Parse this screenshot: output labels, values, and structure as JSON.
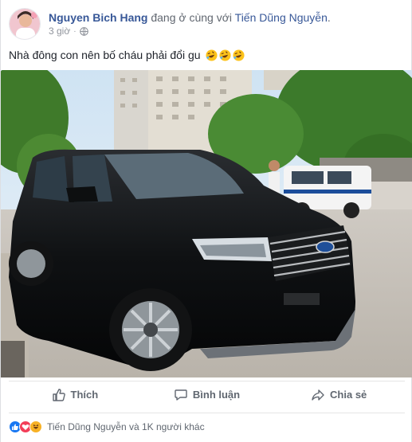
{
  "post": {
    "author": "Nguyen Bich Hang",
    "with_text": "đang ở cùng với",
    "tagged": "Tiến Dũng Nguyễn",
    "period": ".",
    "time": "3 giờ",
    "separator": "·",
    "privacy_icon": "globe-icon",
    "caption": "Nhà đông con nên bố cháu phải đổi gu",
    "caption_emojis": [
      "rofl-emoji",
      "rofl-emoji",
      "rofl-emoji"
    ]
  },
  "actions": {
    "like_label": "Thích",
    "comment_label": "Bình luận",
    "share_label": "Chia sẻ"
  },
  "reactions": {
    "icons": [
      "like-reaction",
      "love-reaction",
      "haha-reaction"
    ],
    "text": "Tiến Dũng Nguyễn và 1K người khác"
  },
  "colors": {
    "link": "#385898",
    "like_blue": "#1877f2",
    "love_red": "#f33e58",
    "haha_yellow": "#f7b125"
  }
}
